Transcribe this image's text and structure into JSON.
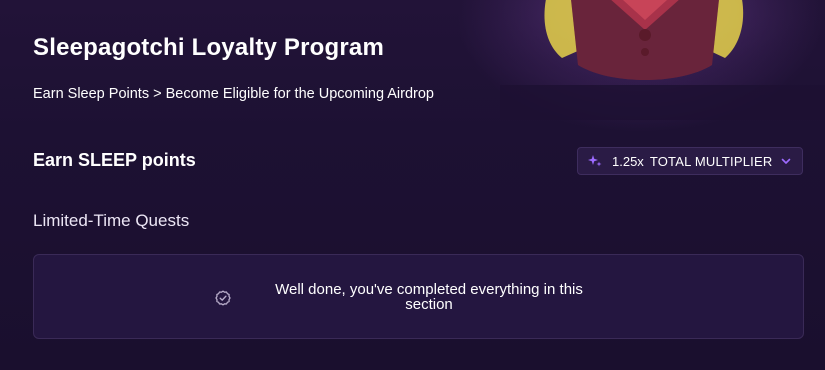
{
  "header": {
    "title": "Sleepagotchi Loyalty Program",
    "subtitle": "Earn Sleep Points > Become Eligible for the Upcoming Airdrop"
  },
  "points": {
    "heading": "Earn SLEEP points",
    "multiplier": {
      "value": "1.25x",
      "label": "TOTAL MULTIPLIER",
      "icon": "sparkle-icon",
      "dropdown_icon": "chevron-down-icon"
    }
  },
  "quests": {
    "heading": "Limited-Time Quests",
    "completed_message": "Well done, you've completed everything in this section",
    "status_icon": "check-circle-icon"
  },
  "colors": {
    "background": "#1b1030",
    "card": "#241640",
    "accent": "#8f5cff"
  }
}
